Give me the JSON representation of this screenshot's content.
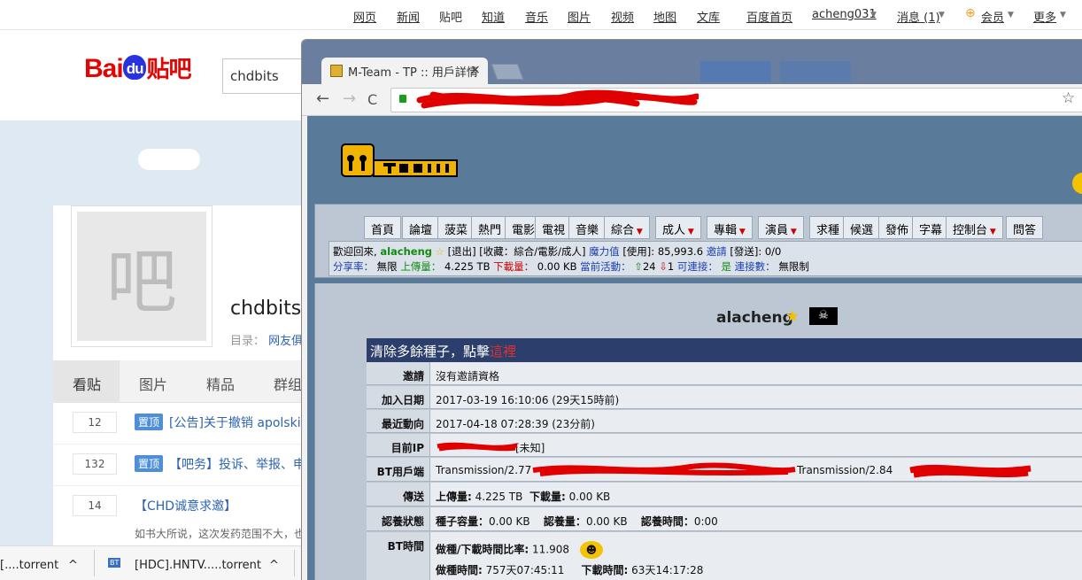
{
  "baidu": {
    "nav": [
      "网页",
      "新闻",
      "贴吧",
      "知道",
      "音乐",
      "图片",
      "视频",
      "地图",
      "文库"
    ],
    "nav_right": {
      "home": "百度首页",
      "user": "acheng031",
      "messages": "消息 (1)",
      "member": "会员",
      "more": "更多"
    },
    "logo_text": "Bai",
    "logo_du": "du",
    "logo_tieba": "贴吧",
    "search_value": "chdbits",
    "bar_icon_char": "吧",
    "bar_name": "chdbits",
    "catalog_label": "目录：",
    "catalog_value": "网友俱",
    "tabs": [
      "看贴",
      "图片",
      "精品",
      "群组"
    ],
    "posts": [
      {
        "count": "12",
        "tag": "置顶",
        "title": "[公告]关于撤销 apolskis"
      },
      {
        "count": "132",
        "tag": "置顶",
        "title": "【吧务】投诉、举报、申"
      },
      {
        "count": "14",
        "tag": "",
        "title": "【CHD诚意求邀】"
      }
    ],
    "post_desc": "如书大所说，这次发药范围不大，也",
    "downloads": [
      {
        "name": "[....torrent"
      },
      {
        "icon": "BT",
        "name": "[HDC].HNTV.....torrent"
      }
    ]
  },
  "browser": {
    "tab_title": "M-Team - TP :: 用戶詳情",
    "tab_close": "×",
    "back": "←",
    "forward": "→",
    "reload": "C",
    "star": "☆"
  },
  "mteam": {
    "menu": [
      {
        "label": "首頁"
      },
      {
        "label": "論壇"
      },
      {
        "label": "菠菜"
      },
      {
        "label": "熱門"
      },
      {
        "label": "電影"
      },
      {
        "label": "電視"
      },
      {
        "label": "音樂"
      },
      {
        "label": "綜合",
        "dropdown": true
      },
      {
        "label": "成人",
        "dropdown": true
      },
      {
        "label": "專輯",
        "dropdown": true
      },
      {
        "label": "演員",
        "dropdown": true
      },
      {
        "label": "求種"
      },
      {
        "label": "候選"
      },
      {
        "label": "發佈"
      },
      {
        "label": "字幕"
      },
      {
        "label": "控制台",
        "dropdown": true
      },
      {
        "label": "問答"
      }
    ],
    "welcome": {
      "prefix": "歡迎回來,",
      "user": "alacheng",
      "logout": "[退出]",
      "bookmarks": "[收藏：綜合/電影/成人]",
      "bonus_label": "魔力值",
      "bonus_value": "[使用]: 85,993.6",
      "invite_label": "邀請",
      "invite_value": "[發送]: 0/0",
      "ratio_label": "分享率：",
      "ratio_value": "無限",
      "up_label": "上傳量：",
      "up_value": "4.225 TB",
      "down_label": "下載量：",
      "down_value": "0.00 KB",
      "active_label": "當前活動：",
      "active_value": "24",
      "active_value2": "1",
      "conn_label": "可連接：",
      "conn_value": "是",
      "conns_label": "連接數：",
      "conns_value": "無限制"
    },
    "profile_name": "alacheng",
    "banner_text": "清除多餘種子，點擊",
    "banner_link": "這裡",
    "rows": [
      {
        "label": "邀請",
        "value": "沒有邀請資格"
      },
      {
        "label": "加入日期",
        "value": "2017-03-19 16:10:06 (29天15時前)"
      },
      {
        "label": "最近動向",
        "value": "2017-04-18 07:28:39 (23分前)"
      },
      {
        "label": "目前IP",
        "value": "[未知]"
      },
      {
        "label": "BT用戶端",
        "value": "Transmission/2.77",
        "value2": "Transmission/2.84"
      },
      {
        "label": "傳送",
        "up_label": "上傳量:",
        "up": "4.225 TB",
        "down_label": "下載量:",
        "down": "0.00 KB"
      },
      {
        "label": "認養狀態",
        "a_label": "種子容量：",
        "a": "0.00 KB",
        "b_label": "認養量：",
        "b": "0.00 KB",
        "c_label": "認養時間：",
        "c": "0:00"
      },
      {
        "label": "BT時間",
        "ratio_label": "做種/下載時間比率:",
        "ratio": "11.908",
        "seed_label": "做種時間:",
        "seed": "757天07:45:11",
        "dl_label": "下載時間:",
        "dl": "63天14:17:28"
      }
    ]
  }
}
